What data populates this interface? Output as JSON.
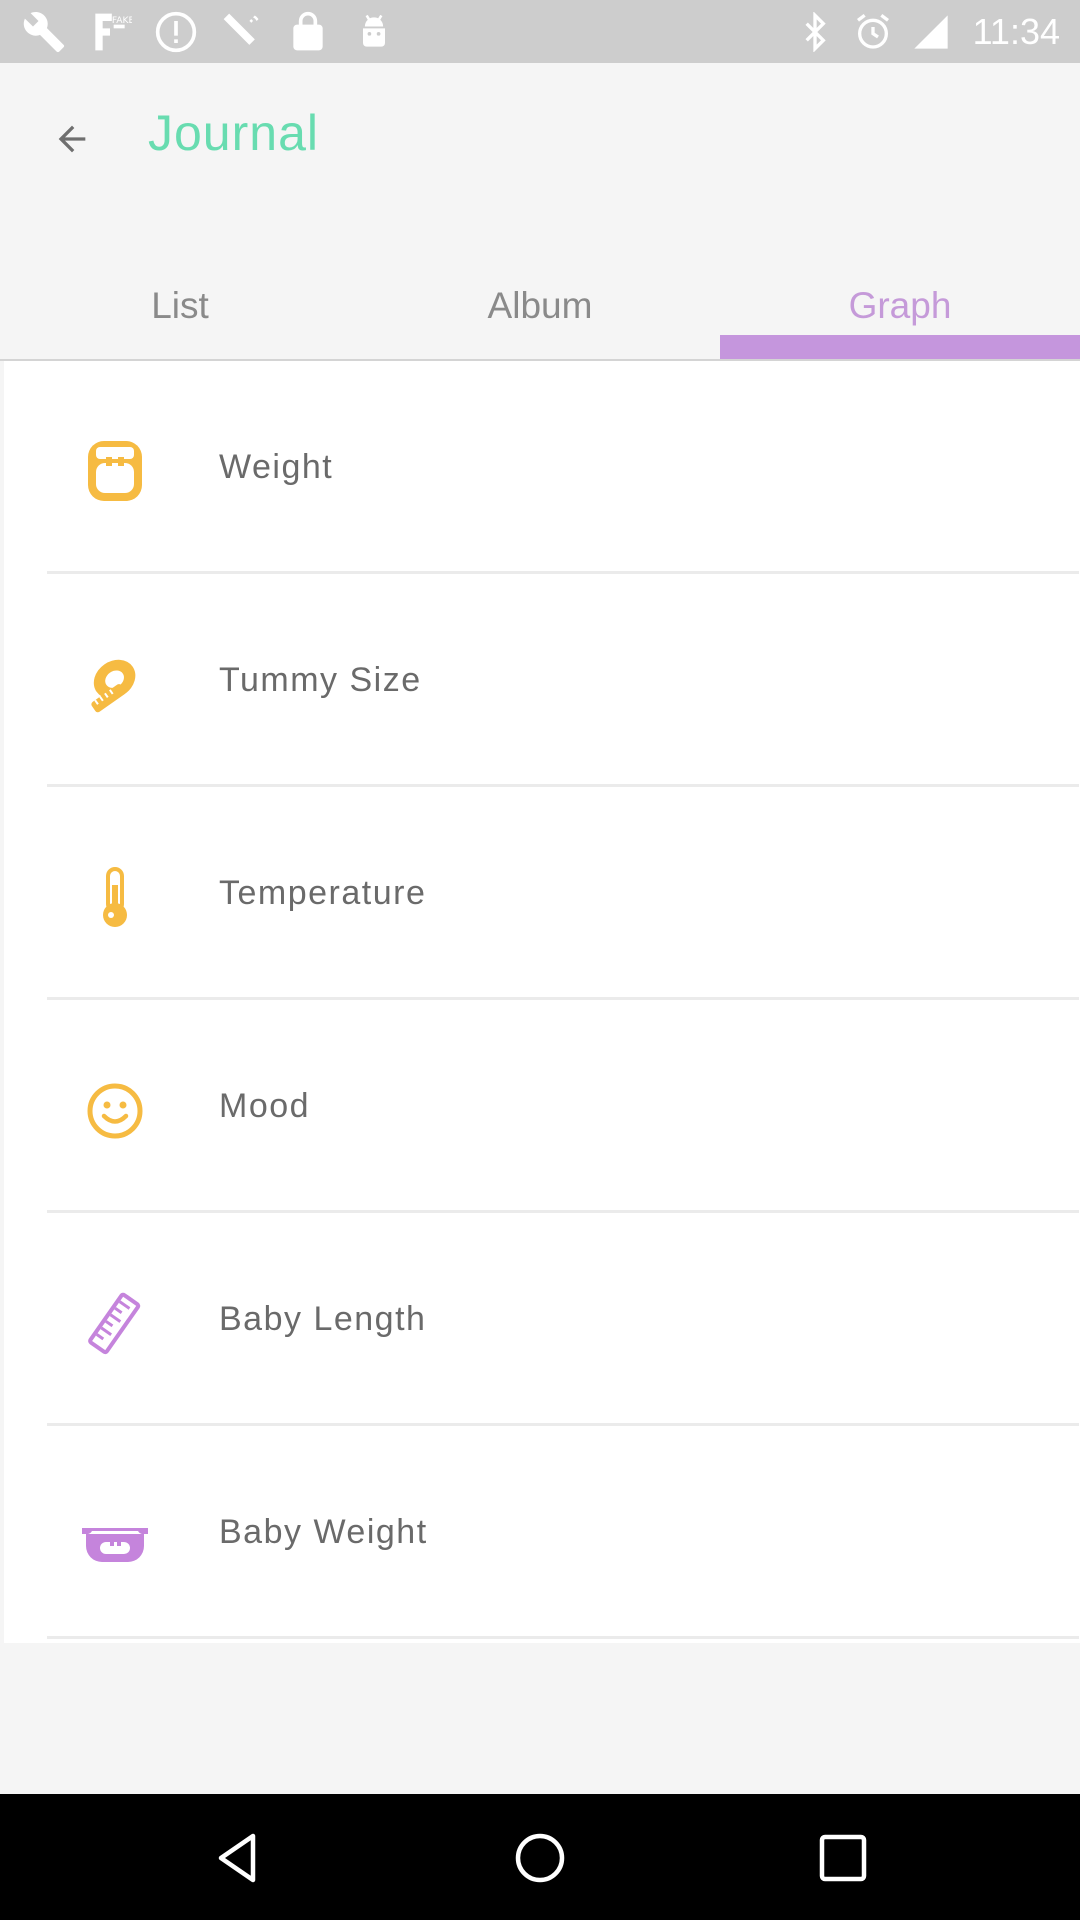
{
  "status_bar": {
    "time": "11:34",
    "left_icons": [
      "wrench-icon",
      "fake-gps-icon",
      "notification-icon",
      "satellite-icon",
      "lock-icon",
      "android-icon"
    ],
    "right_icons": [
      "bluetooth-icon",
      "alarm-icon",
      "signal-icon"
    ]
  },
  "header": {
    "title": "Journal",
    "back_icon": "arrow-left-icon"
  },
  "tabs": [
    {
      "label": "List",
      "active": false
    },
    {
      "label": "Album",
      "active": false
    },
    {
      "label": "Graph",
      "active": true
    }
  ],
  "items": [
    {
      "label": "Weight",
      "icon": "scale-icon"
    },
    {
      "label": "Tummy Size",
      "icon": "measuring-tape-icon"
    },
    {
      "label": "Temperature",
      "icon": "thermometer-icon"
    },
    {
      "label": "Mood",
      "icon": "smiley-icon"
    },
    {
      "label": "Baby Length",
      "icon": "ruler-icon"
    },
    {
      "label": "Baby Weight",
      "icon": "baby-scale-icon"
    }
  ],
  "colors": {
    "title": "#68dcb0",
    "tab_active": "#c59ad9",
    "tab_indicator": "#c596dd",
    "tab_inactive": "#8a8a8a",
    "icon_orange": "#f6bb42",
    "icon_purple": "#c584dc",
    "status_bar": "#cdcdcd",
    "nav_bar": "#000000"
  },
  "nav_bar": {
    "buttons": [
      "back-icon",
      "home-icon",
      "recents-icon"
    ]
  }
}
